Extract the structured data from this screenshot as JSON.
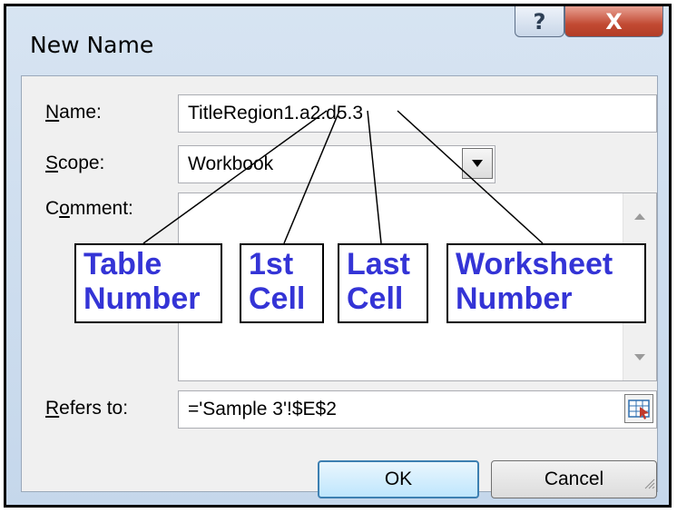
{
  "dialog": {
    "title": "New Name",
    "help_symbol": "?",
    "close_symbol": "X"
  },
  "form": {
    "name_label": "Name:",
    "name_value": "TitleRegion1.a2.d5.3",
    "scope_label": "Scope:",
    "scope_value": "Workbook",
    "comment_label": "Comment:",
    "refers_label": "Refers to:",
    "refers_value": "='Sample 3'!$E$2"
  },
  "buttons": {
    "ok": "OK",
    "cancel": "Cancel"
  },
  "callouts": [
    {
      "line1": "Table",
      "line2": "Number"
    },
    {
      "line1": "1st",
      "line2": "Cell"
    },
    {
      "line1": "Last",
      "line2": "Cell"
    },
    {
      "line1": "Worksheet",
      "line2": "Number"
    }
  ],
  "colors": {
    "callout_text": "#3434d6",
    "close_button": "#c24a33",
    "title_gradient": "#c5d7eb"
  },
  "icons": [
    "help-icon",
    "close-icon",
    "chevron-down-icon",
    "scroll-up-icon",
    "scroll-down-icon",
    "range-picker-icon",
    "resize-grip-icon"
  ]
}
